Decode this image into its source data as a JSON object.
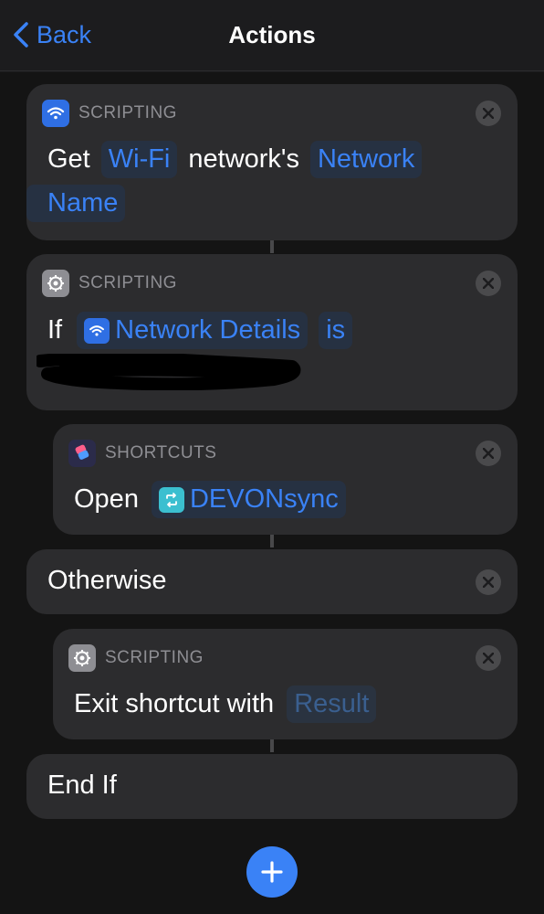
{
  "nav": {
    "back_label": "Back",
    "title": "Actions"
  },
  "actions": [
    {
      "category": "SCRIPTING",
      "icon": "wifi-icon",
      "verb": "Get",
      "token1": "Wi-Fi",
      "middle": "network's",
      "token2a": "Network",
      "token2b": "Name"
    },
    {
      "category": "SCRIPTING",
      "icon": "gear-icon",
      "verb": "If",
      "token1": "Network Details",
      "token2": "is"
    },
    {
      "category": "SHORTCUTS",
      "icon": "shortcuts-icon",
      "verb": "Open",
      "token1": "DEVONsync"
    },
    {
      "label": "Otherwise"
    },
    {
      "category": "SCRIPTING",
      "icon": "gear-icon",
      "verb": "Exit shortcut with",
      "token1": "Result"
    },
    {
      "label": "End If"
    }
  ],
  "colors": {
    "accent": "#3a82f6",
    "card": "#2c2c2e",
    "background": "#141414"
  }
}
